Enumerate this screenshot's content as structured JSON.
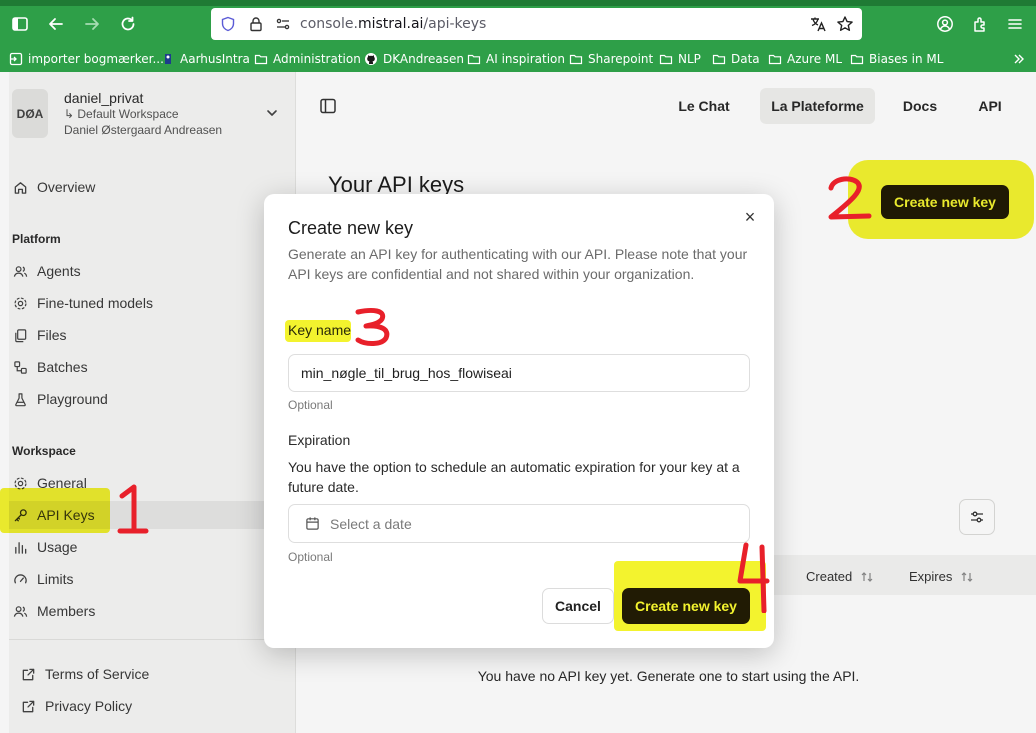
{
  "browser": {
    "url_prefix": "console.",
    "url_domain": "mistral.ai",
    "url_path": "/api-keys",
    "bookmarks": [
      {
        "label": "importer bogmærker...",
        "icon": "import-icon"
      },
      {
        "label": "AarhusIntra",
        "icon": "site-icon"
      },
      {
        "label": "Administration",
        "icon": "folder-icon"
      },
      {
        "label": "DKAndreasen",
        "icon": "github-icon"
      },
      {
        "label": "AI inspiration",
        "icon": "folder-icon"
      },
      {
        "label": "Sharepoint",
        "icon": "folder-icon"
      },
      {
        "label": "NLP",
        "icon": "folder-icon"
      },
      {
        "label": "Data",
        "icon": "folder-icon"
      },
      {
        "label": "Azure ML",
        "icon": "folder-icon"
      },
      {
        "label": "Biases in ML",
        "icon": "folder-icon"
      }
    ]
  },
  "sidebar": {
    "avatar": "DØA",
    "org_name": "daniel_privat",
    "workspace": "↳ Default Workspace",
    "user_name": "Daniel Østergaard Andreasen",
    "overview": "Overview",
    "platform_label": "Platform",
    "platform_items": [
      "Agents",
      "Fine-tuned models",
      "Files",
      "Batches",
      "Playground"
    ],
    "workspace_label": "Workspace",
    "workspace_items": [
      "General",
      "API Keys",
      "Usage",
      "Limits",
      "Members"
    ],
    "active_item": "API Keys",
    "footer_items": [
      "Terms of Service",
      "Privacy Policy"
    ]
  },
  "header": {
    "links": [
      "Le Chat",
      "La Plateforme",
      "Docs",
      "API"
    ],
    "active_link": "La Plateforme"
  },
  "page": {
    "title": "Your API keys",
    "create_button": "Create new key",
    "columns": [
      "Created",
      "Expires"
    ],
    "empty_message": "You have no API key yet. Generate one to start using the API."
  },
  "modal": {
    "title": "Create new key",
    "description": "Generate an API key for authenticating with our API. Please note that your API keys are confidential and not shared within your organization.",
    "key_name_label": "Key name",
    "key_name_value": "min_nøgle_til_brug_hos_flowiseai",
    "optional": "Optional",
    "expiration_label": "Expiration",
    "expiration_desc": "You have the option to schedule an automatic expiration for your key at a future date.",
    "date_placeholder": "Select a date",
    "cancel": "Cancel",
    "submit": "Create new key"
  },
  "colors": {
    "browser_green": "#2e9f48",
    "button_dark": "#221c14",
    "highlight_yellow": "#f0f000",
    "annotation_red": "#e8202a"
  }
}
